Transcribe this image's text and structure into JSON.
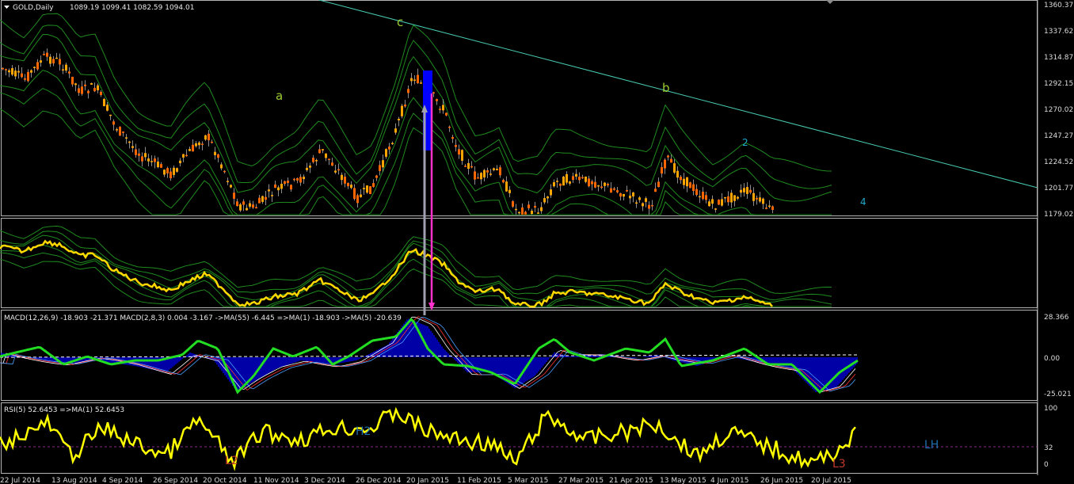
{
  "window": {
    "symbol_label": "GOLD,Daily",
    "ohlc_label": "1089.19 1099.41 1082.59 1094.01",
    "menu_icon": "triangle-down-icon"
  },
  "price_panel": {
    "ticks": [
      "1360.37",
      "1337.62",
      "1314.87",
      "1292.15",
      "1270.02",
      "1247.27",
      "1224.52",
      "1201.77",
      "1179.02"
    ],
    "wave_labels": [
      {
        "text": "c",
        "color": "#9acd32"
      },
      {
        "text": "a",
        "color": "#9acd32"
      },
      {
        "text": "b",
        "color": "#9acd32"
      },
      {
        "text": "2",
        "color": "#1fa8c9"
      },
      {
        "text": "4",
        "color": "#1fa8c9"
      }
    ]
  },
  "macd_panel": {
    "label": "MACD(12,26,9) -18.903 -21.371  MACD(2,8,3) 0.004 -3.167  ->MA(55) -6.445  =>MA(1) -18.903  ->MA(5) -20.639",
    "ticks": [
      "28.366",
      "0.00",
      "-25.021"
    ]
  },
  "rsi_panel": {
    "label": "RSI(5) 52.6453  =>MA(1) 52.6453",
    "ticks": [
      "100",
      "32",
      "0"
    ],
    "annotations": [
      {
        "text": "L2",
        "color": "#c0392b"
      },
      {
        "text": "H2",
        "color": "#1f6fb0"
      },
      {
        "text": "L3",
        "color": "#c0392b"
      },
      {
        "text": "LH",
        "color": "#1f6fb0"
      }
    ]
  },
  "date_axis": [
    "22 Jul 2014",
    "13 Aug 2014",
    "4 Sep 2014",
    "26 Sep 2014",
    "20 Oct 2014",
    "11 Nov 2014",
    "3 Dec 2014",
    "26 Dec 2014",
    "20 Jan 2015",
    "11 Feb 2015",
    "5 Mar 2015",
    "27 Mar 2015",
    "21 Apr 2015",
    "13 May 2015",
    "4 Jun 2015",
    "26 Jun 2015",
    "20 Jul 2015"
  ],
  "colors": {
    "background": "#000000",
    "candle_up": "#ffa500",
    "candle_down": "#ff6600",
    "envelope": "#1f8a1f",
    "trendline": "#48c9b0",
    "smoothed_price": "#ffd800",
    "macd_hist": "#0000ff",
    "macd_fast": "#22dd22",
    "rsi_line": "#ffff00",
    "level_line": "#8b2a8b",
    "vertical_gray": "#a0a0b0",
    "vertical_magenta": "#ff33cc"
  }
}
